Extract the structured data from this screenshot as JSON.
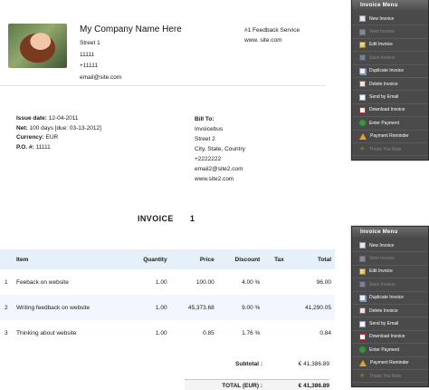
{
  "company": {
    "name": "My Company Name Here",
    "street": "Street 1",
    "zip": "11111",
    "phone": "+11111",
    "email": "email@site.com",
    "service": "#1 Feedback Service",
    "website": "www. site.com"
  },
  "invoice_meta": {
    "issue_label": "Issue date:",
    "issue_value": "12-04-2011",
    "net_label": "Net:",
    "net_value": "100 days [due: 03-13-2012]",
    "currency_label": "Currency:",
    "currency_value": "EUR",
    "po_label": "P.O. #:",
    "po_value": "11111"
  },
  "bill_to": {
    "heading": "Bill To:",
    "name": "Invoicebus",
    "street": "Street 2",
    "city": "City, State, Country",
    "phone": "+2222222",
    "email": "email2@site2.com",
    "website": "www.site2.com"
  },
  "invoice_title": {
    "label": "INVOICE",
    "number": "1"
  },
  "table": {
    "headers": {
      "item": "Item",
      "quantity": "Quantity",
      "price": "Price",
      "discount": "Discount",
      "tax": "Tax",
      "total": "Total"
    },
    "rows": [
      {
        "no": "1",
        "item": "Feeback on website",
        "quantity": "1.00",
        "price": "100.00",
        "discount": "4.00 %",
        "tax": "",
        "total": "96.00"
      },
      {
        "no": "2",
        "item": "Writing feedback on website",
        "quantity": "1.00",
        "price": "45,373.68",
        "discount": "9.00 %",
        "tax": "",
        "total": "41,290.05"
      },
      {
        "no": "3",
        "item": "Thinking about website",
        "quantity": "1.00",
        "price": "0.85",
        "discount": "1.76 %",
        "tax": "",
        "total": "0.84"
      }
    ]
  },
  "totals": {
    "subtotal_label": "Subtotal :",
    "subtotal_value": "€ 41,386.89",
    "total_label": "TOTAL (EUR) :",
    "total_value": "€ 41,386.89"
  },
  "menus": [
    {
      "title": "Invoice Menu",
      "items": [
        {
          "label": "New Invoice",
          "icon": "new-document-icon",
          "enabled": true
        },
        {
          "label": "View Invoice",
          "icon": "view-icon",
          "enabled": false
        },
        {
          "label": "Edit Invoice",
          "icon": "edit-icon",
          "enabled": true
        },
        {
          "label": "Save Invoice",
          "icon": "save-icon",
          "enabled": false
        },
        {
          "label": "Duplicate Invoice",
          "icon": "duplicate-icon",
          "enabled": true
        },
        {
          "label": "Delete Invoice",
          "icon": "delete-icon",
          "enabled": true
        },
        {
          "label": "Send by Email",
          "icon": "email-icon",
          "enabled": true
        },
        {
          "label": "Download Invoice",
          "icon": "pdf-icon",
          "enabled": true
        },
        {
          "label": "Enter Payment",
          "icon": "payment-icon",
          "enabled": true
        },
        {
          "label": "Payment Reminder",
          "icon": "reminder-icon",
          "enabled": true
        },
        {
          "label": "Thank You Note",
          "icon": "thank-you-icon",
          "enabled": false
        }
      ]
    },
    {
      "title": "Invoice Menu",
      "items": [
        {
          "label": "New Invoice",
          "icon": "new-document-icon",
          "enabled": true
        },
        {
          "label": "View Invoice",
          "icon": "view-icon",
          "enabled": false
        },
        {
          "label": "Edit Invoice",
          "icon": "edit-icon",
          "enabled": true
        },
        {
          "label": "Save Invoice",
          "icon": "save-icon",
          "enabled": false
        },
        {
          "label": "Duplicate Invoice",
          "icon": "duplicate-icon",
          "enabled": true
        },
        {
          "label": "Delete Invoice",
          "icon": "delete-icon",
          "enabled": true
        },
        {
          "label": "Send by Email",
          "icon": "email-icon",
          "enabled": true
        },
        {
          "label": "Download Invoice",
          "icon": "pdf-icon",
          "enabled": true
        },
        {
          "label": "Enter Payment",
          "icon": "payment-icon",
          "enabled": true
        },
        {
          "label": "Payment Reminder",
          "icon": "reminder-icon",
          "enabled": true
        },
        {
          "label": "Thank You Note",
          "icon": "thank-you-icon",
          "enabled": false
        }
      ]
    }
  ],
  "colors": {
    "table_header_bg": "#e6f0f8",
    "menu_bg": "#4a4a4a",
    "menu_disabled_text": "#8a8a8a"
  }
}
